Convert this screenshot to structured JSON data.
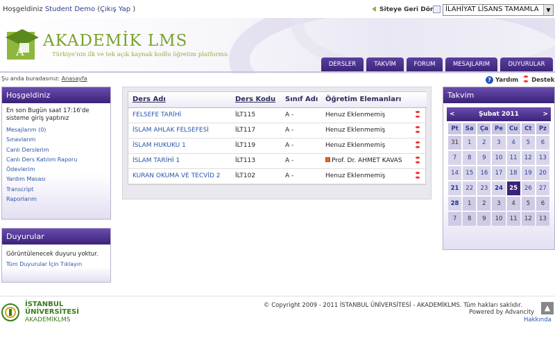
{
  "topbar": {
    "greeting": "Hoşgeldiniz",
    "user": "Student Demo",
    "logout": "Çıkış Yap",
    "back_link": "Siteye Geri Dön",
    "program_select": "İLAHİYAT LİSANS TAMAMLA"
  },
  "brand": {
    "title": "AKADEMİK LMS",
    "slogan": "Türkiye'nin ilk ve tek açık kaynak kodlu öğretim platformu"
  },
  "nav": {
    "tabs": [
      "DERSLER",
      "TAKVİM",
      "FORUM",
      "MESAJLARIM",
      "DUYURULAR"
    ]
  },
  "breadcrumb": {
    "prefix": "Şu anda buradasınız:",
    "home": "Anasayfa"
  },
  "help": {
    "yardim": "Yardım",
    "destek": "Destek"
  },
  "welcome_panel": {
    "title": "Hoşgeldiniz",
    "intro": "En son Bugün saat 17:16'de sisteme giriş yaptınız",
    "links": [
      "Mesajlarım (0)",
      "Sınavlarım",
      "Canlı Derslerim",
      "Canlı Ders Katılım Raporu",
      "Ödevlerim",
      "Yardım Masası",
      "Transcript",
      "Raporlarım"
    ]
  },
  "announce_panel": {
    "title": "Duyurular",
    "empty": "Görüntülenecek duyuru yoktur.",
    "link": "Tüm Duyurular İçin Tıklayın"
  },
  "courses": {
    "headers": [
      "Ders Adı",
      "Ders Kodu",
      "Sınıf Adı",
      "Öğretim Elemanları"
    ],
    "rows": [
      {
        "name": "FELSEFE TARİHİ",
        "code": "İLT115",
        "class": "A",
        "dash": "-",
        "teacher": "Henuz Eklenmemiş"
      },
      {
        "name": "İSLAM AHLAK FELSEFESİ",
        "code": "İLT117",
        "class": "A",
        "dash": "-",
        "teacher": "Henuz Eklenmemiş"
      },
      {
        "name": "İSLAM HUKUKU 1",
        "code": "İLT119",
        "class": "A",
        "dash": "-",
        "teacher": "Henuz Eklenmemiş"
      },
      {
        "name": "İSLAM TARİHİ 1",
        "code": "İLT113",
        "class": "A",
        "dash": "-",
        "teacher": "Prof. Dr. AHMET KAVAS"
      },
      {
        "name": "KURAN OKUMA VE TECVİD 2",
        "code": "İLT102",
        "class": "A",
        "dash": "-",
        "teacher": "Henuz Eklenmemiş"
      }
    ]
  },
  "calendar": {
    "title": "Takvim",
    "month": "Şubat 2011",
    "prev": "<",
    "next": ">",
    "weekdays": [
      "Pt",
      "Sa",
      "Ça",
      "Pe",
      "Cu",
      "Ct",
      "Pz"
    ],
    "weeks": [
      [
        "31",
        "1",
        "2",
        "3",
        "4",
        "5",
        "6"
      ],
      [
        "7",
        "8",
        "9",
        "10",
        "11",
        "12",
        "13"
      ],
      [
        "14",
        "15",
        "16",
        "17",
        "18",
        "19",
        "20"
      ],
      [
        "21",
        "22",
        "23",
        "24",
        "25",
        "26",
        "27"
      ],
      [
        "28",
        "1",
        "2",
        "3",
        "4",
        "5",
        "6"
      ],
      [
        "7",
        "8",
        "9",
        "10",
        "11",
        "12",
        "13"
      ]
    ],
    "today": "25"
  },
  "footer": {
    "iu_line1": "İSTANBUL",
    "iu_line2": "ÜNİVERSİTESİ",
    "iu_line3": "AKADEMİKLMS",
    "copyright": "© Copyright 2009 - 2011 İSTANBUL ÜNİVERSİTESİ - AKADEMİKLMS. Tüm hakları saklıdır.",
    "powered": "Powered by Advancity",
    "about": "Hakkında"
  },
  "colors": {
    "accent": "#3b2478",
    "link": "#2a55aa",
    "brand_green": "#7aa12f"
  }
}
